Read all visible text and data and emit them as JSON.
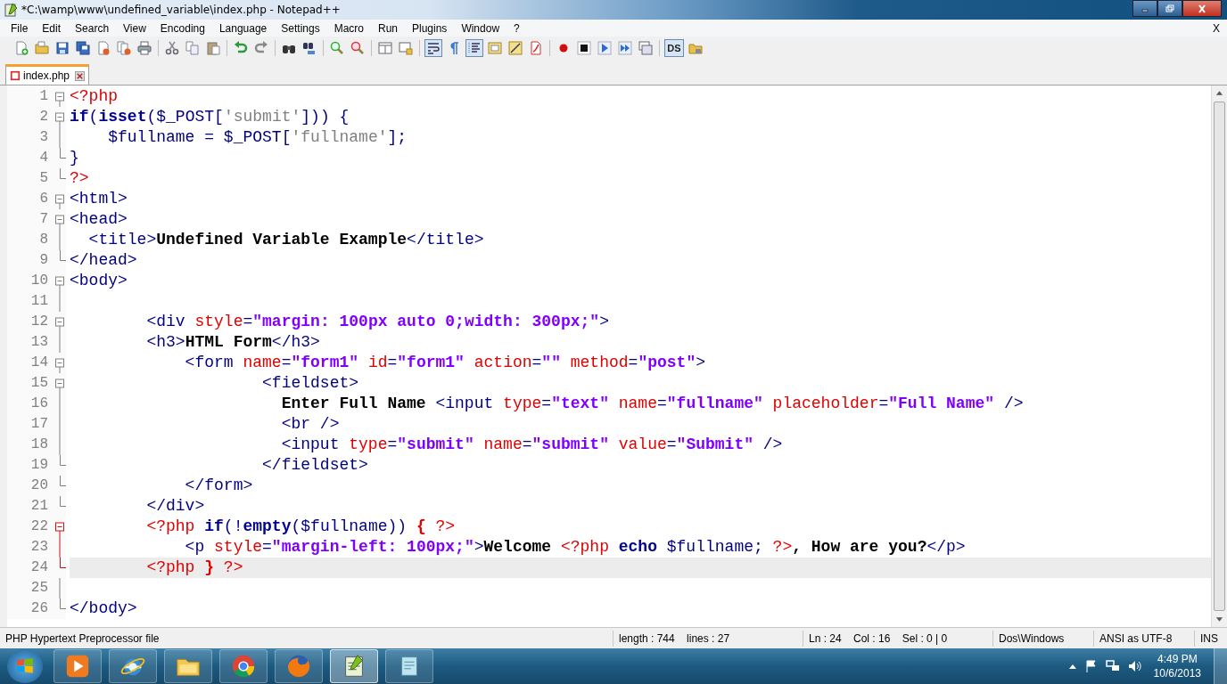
{
  "window": {
    "title": "*C:\\wamp\\www\\undefined_variable\\index.php - Notepad++"
  },
  "menu": [
    "File",
    "Edit",
    "Search",
    "View",
    "Encoding",
    "Language",
    "Settings",
    "Macro",
    "Run",
    "Plugins",
    "Window",
    "?"
  ],
  "menu_close": "X",
  "toolbar": [
    {
      "kind": "new",
      "pressed": false
    },
    {
      "kind": "open",
      "pressed": false
    },
    {
      "kind": "save",
      "pressed": false
    },
    {
      "kind": "save-all",
      "pressed": false
    },
    {
      "kind": "close",
      "pressed": false
    },
    {
      "kind": "close-all",
      "pressed": false
    },
    {
      "kind": "print",
      "pressed": false
    },
    {
      "kind": "sep"
    },
    {
      "kind": "cut",
      "pressed": false
    },
    {
      "kind": "copy",
      "pressed": false
    },
    {
      "kind": "paste",
      "pressed": false
    },
    {
      "kind": "sep"
    },
    {
      "kind": "undo",
      "pressed": false
    },
    {
      "kind": "redo",
      "pressed": false
    },
    {
      "kind": "sep"
    },
    {
      "kind": "find",
      "pressed": false
    },
    {
      "kind": "replace",
      "pressed": false
    },
    {
      "kind": "sep"
    },
    {
      "kind": "zoom-in",
      "pressed": false
    },
    {
      "kind": "zoom-out",
      "pressed": false
    },
    {
      "kind": "sep"
    },
    {
      "kind": "sync-v",
      "pressed": false
    },
    {
      "kind": "sync-h",
      "pressed": false
    },
    {
      "kind": "sep"
    },
    {
      "kind": "wrap",
      "pressed": true
    },
    {
      "kind": "pilcrow",
      "pressed": false
    },
    {
      "kind": "indent",
      "pressed": true
    },
    {
      "kind": "map",
      "pressed": false
    },
    {
      "kind": "function",
      "pressed": false
    },
    {
      "kind": "lang",
      "pressed": false
    },
    {
      "kind": "sep"
    },
    {
      "kind": "record",
      "pressed": false
    },
    {
      "kind": "stop",
      "pressed": false
    },
    {
      "kind": "play",
      "pressed": false
    },
    {
      "kind": "play-many",
      "pressed": false
    },
    {
      "kind": "save-macro",
      "pressed": false
    },
    {
      "kind": "sep"
    },
    {
      "kind": "text",
      "label": "DS",
      "pressed": true
    },
    {
      "kind": "folder-lock",
      "pressed": false
    }
  ],
  "tabs": [
    {
      "label": "index.php",
      "selected": true,
      "modified": true
    }
  ],
  "lines": [
    {
      "number": "1",
      "fold": {
        "kind": "open",
        "active": false
      },
      "current": false,
      "tokens": [
        {
          "kind": "phpdelim",
          "text": "<?php"
        }
      ]
    },
    {
      "number": "2",
      "fold": {
        "kind": "open",
        "active": false
      },
      "current": false,
      "tokens": [
        {
          "kind": "kw",
          "text": "if"
        },
        {
          "kind": "op",
          "text": "("
        },
        {
          "kind": "kw",
          "text": "isset"
        },
        {
          "kind": "op",
          "text": "("
        },
        {
          "kind": "var",
          "text": "$_POST"
        },
        {
          "kind": "op",
          "text": "["
        },
        {
          "kind": "pstr",
          "text": "'submit'"
        },
        {
          "kind": "op",
          "text": "])) {"
        }
      ]
    },
    {
      "number": "3",
      "fold": {
        "kind": "line",
        "active": false
      },
      "current": false,
      "tokens": [
        {
          "kind": "var",
          "text": "    $fullname"
        },
        {
          "kind": "op",
          "text": " = "
        },
        {
          "kind": "var",
          "text": "$_POST"
        },
        {
          "kind": "op",
          "text": "["
        },
        {
          "kind": "pstr",
          "text": "'fullname'"
        },
        {
          "kind": "op",
          "text": "];"
        }
      ]
    },
    {
      "number": "4",
      "fold": {
        "kind": "end",
        "active": false
      },
      "current": false,
      "tokens": [
        {
          "kind": "op",
          "text": "}"
        }
      ]
    },
    {
      "number": "5",
      "fold": {
        "kind": "end",
        "active": false
      },
      "current": false,
      "tokens": [
        {
          "kind": "phpdelim",
          "text": "?>"
        }
      ]
    },
    {
      "number": "6",
      "fold": {
        "kind": "open",
        "active": false
      },
      "current": false,
      "tokens": [
        {
          "kind": "tag",
          "text": "<html>"
        }
      ]
    },
    {
      "number": "7",
      "fold": {
        "kind": "open",
        "active": false
      },
      "current": false,
      "tokens": [
        {
          "kind": "tag",
          "text": "<head>"
        }
      ]
    },
    {
      "number": "8",
      "fold": {
        "kind": "line",
        "active": false
      },
      "current": false,
      "tokens": [
        {
          "kind": "tag",
          "text": "  <title>"
        },
        {
          "kind": "text",
          "text": "Undefined Variable Example"
        },
        {
          "kind": "tag",
          "text": "</title>"
        }
      ]
    },
    {
      "number": "9",
      "fold": {
        "kind": "end",
        "active": false
      },
      "current": false,
      "tokens": [
        {
          "kind": "tag",
          "text": "</head>"
        }
      ]
    },
    {
      "number": "10",
      "fold": {
        "kind": "open",
        "active": false
      },
      "current": false,
      "tokens": [
        {
          "kind": "tag",
          "text": "<body>"
        }
      ]
    },
    {
      "number": "11",
      "fold": {
        "kind": "line",
        "active": false
      },
      "current": false
    },
    {
      "number": "12",
      "fold": {
        "kind": "open",
        "active": false
      },
      "current": false,
      "tokens": [
        {
          "kind": "tag",
          "text": "        <div "
        },
        {
          "kind": "attr",
          "text": "style"
        },
        {
          "kind": "tag",
          "text": "="
        },
        {
          "kind": "str",
          "text": "\"margin: 100px auto 0;width: 300px;\""
        },
        {
          "kind": "tag",
          "text": ">"
        }
      ]
    },
    {
      "number": "13",
      "fold": {
        "kind": "line",
        "active": false
      },
      "current": false,
      "tokens": [
        {
          "kind": "tag",
          "text": "        <h3>"
        },
        {
          "kind": "text",
          "text": "HTML Form"
        },
        {
          "kind": "tag",
          "text": "</h3>"
        }
      ]
    },
    {
      "number": "14",
      "fold": {
        "kind": "open",
        "active": false
      },
      "current": false,
      "tokens": [
        {
          "kind": "tag",
          "text": "            <form "
        },
        {
          "kind": "attr",
          "text": "name"
        },
        {
          "kind": "tag",
          "text": "="
        },
        {
          "kind": "str",
          "text": "\"form1\" "
        },
        {
          "kind": "attr",
          "text": "id"
        },
        {
          "kind": "tag",
          "text": "="
        },
        {
          "kind": "str",
          "text": "\"form1\" "
        },
        {
          "kind": "attr",
          "text": "action"
        },
        {
          "kind": "tag",
          "text": "="
        },
        {
          "kind": "str",
          "text": "\"\" "
        },
        {
          "kind": "attr",
          "text": "method"
        },
        {
          "kind": "tag",
          "text": "="
        },
        {
          "kind": "str",
          "text": "\"post\""
        },
        {
          "kind": "tag",
          "text": ">"
        }
      ]
    },
    {
      "number": "15",
      "fold": {
        "kind": "open",
        "active": false
      },
      "current": false,
      "tokens": [
        {
          "kind": "tag",
          "text": "                    <fieldset>"
        }
      ]
    },
    {
      "number": "16",
      "fold": {
        "kind": "line",
        "active": false
      },
      "current": false,
      "tokens": [
        {
          "kind": "text",
          "text": "                      Enter Full Name "
        },
        {
          "kind": "tag",
          "text": "<input "
        },
        {
          "kind": "attr",
          "text": "type"
        },
        {
          "kind": "tag",
          "text": "="
        },
        {
          "kind": "str",
          "text": "\"text\" "
        },
        {
          "kind": "attr",
          "text": "name"
        },
        {
          "kind": "tag",
          "text": "="
        },
        {
          "kind": "str",
          "text": "\"fullname\" "
        },
        {
          "kind": "attr",
          "text": "placeholder"
        },
        {
          "kind": "tag",
          "text": "="
        },
        {
          "kind": "str",
          "text": "\"Full Name\""
        },
        {
          "kind": "tag",
          "text": " />"
        }
      ]
    },
    {
      "number": "17",
      "fold": {
        "kind": "line",
        "active": false
      },
      "current": false,
      "tokens": [
        {
          "kind": "tag",
          "text": "                      <br />"
        }
      ]
    },
    {
      "number": "18",
      "fold": {
        "kind": "line",
        "active": false
      },
      "current": false,
      "tokens": [
        {
          "kind": "tag",
          "text": "                      <input "
        },
        {
          "kind": "attr",
          "text": "type"
        },
        {
          "kind": "tag",
          "text": "="
        },
        {
          "kind": "str",
          "text": "\"submit\" "
        },
        {
          "kind": "attr",
          "text": "name"
        },
        {
          "kind": "tag",
          "text": "="
        },
        {
          "kind": "str",
          "text": "\"submit\" "
        },
        {
          "kind": "attr",
          "text": "value"
        },
        {
          "kind": "tag",
          "text": "="
        },
        {
          "kind": "str",
          "text": "\"Submit\""
        },
        {
          "kind": "tag",
          "text": " />"
        }
      ]
    },
    {
      "number": "19",
      "fold": {
        "kind": "end",
        "active": false
      },
      "current": false,
      "tokens": [
        {
          "kind": "tag",
          "text": "                    </fieldset>"
        }
      ]
    },
    {
      "number": "20",
      "fold": {
        "kind": "end",
        "active": false
      },
      "current": false,
      "tokens": [
        {
          "kind": "tag",
          "text": "            </form>"
        }
      ]
    },
    {
      "number": "21",
      "fold": {
        "kind": "end",
        "active": false
      },
      "current": false,
      "tokens": [
        {
          "kind": "tag",
          "text": "        </div>"
        }
      ]
    },
    {
      "number": "22",
      "fold": {
        "kind": "open",
        "active": true
      },
      "current": false,
      "tokens": [
        {
          "kind": "phpdelim",
          "text": "        <?php "
        },
        {
          "kind": "kw",
          "text": "if"
        },
        {
          "kind": "op",
          "text": "(!"
        },
        {
          "kind": "kw",
          "text": "empty"
        },
        {
          "kind": "op",
          "text": "("
        },
        {
          "kind": "var",
          "text": "$fullname"
        },
        {
          "kind": "op",
          "text": ")) "
        },
        {
          "kind": "brace",
          "text": "{ "
        },
        {
          "kind": "phpdelim",
          "text": "?>"
        }
      ]
    },
    {
      "number": "23",
      "fold": {
        "kind": "line",
        "active": true
      },
      "current": false,
      "tokens": [
        {
          "kind": "tag",
          "text": "            <p "
        },
        {
          "kind": "attr",
          "text": "style"
        },
        {
          "kind": "tag",
          "text": "="
        },
        {
          "kind": "str",
          "text": "\"margin-left: 100px;\""
        },
        {
          "kind": "tag",
          "text": ">"
        },
        {
          "kind": "text",
          "text": "Welcome "
        },
        {
          "kind": "phpdelim",
          "text": "<?php "
        },
        {
          "kind": "kw",
          "text": "echo "
        },
        {
          "kind": "var",
          "text": "$fullname"
        },
        {
          "kind": "op",
          "text": "; "
        },
        {
          "kind": "phpdelim",
          "text": "?>"
        },
        {
          "kind": "text",
          "text": ", How are you?"
        },
        {
          "kind": "tag",
          "text": "</p>"
        }
      ]
    },
    {
      "number": "24",
      "fold": {
        "kind": "end",
        "active": true
      },
      "current": true,
      "tokens": [
        {
          "kind": "phpdelim",
          "text": "        <?php "
        },
        {
          "kind": "brace",
          "text": "} "
        },
        {
          "kind": "phpdelim",
          "text": "?>"
        }
      ]
    },
    {
      "number": "25",
      "fold": {
        "kind": "line",
        "active": false
      },
      "current": false
    },
    {
      "number": "26",
      "fold": {
        "kind": "end",
        "active": false
      },
      "current": false,
      "tokens": [
        {
          "kind": "tag",
          "text": "</body>"
        }
      ]
    }
  ],
  "status_bar": [
    {
      "text": "PHP Hypertext Preprocessor file",
      "kind": "wide"
    },
    {
      "text": "length : 744    lines : 27",
      "kind": "mid"
    },
    {
      "text": "Ln : 24    Col : 16    Sel : 0 | 0",
      "kind": "mid"
    },
    {
      "text": "Dos\\Windows",
      "kind": "small"
    },
    {
      "text": "ANSI as UTF-8",
      "kind": "small"
    },
    {
      "text": "INS",
      "kind": "tiny"
    }
  ],
  "taskbar": {
    "apps": [
      {
        "kind": "media",
        "selected": false
      },
      {
        "kind": "ie",
        "selected": false
      },
      {
        "kind": "folder",
        "selected": false
      },
      {
        "kind": "chrome",
        "selected": false
      },
      {
        "kind": "firefox",
        "selected": false
      },
      {
        "kind": "npp",
        "selected": true
      },
      {
        "kind": "note",
        "selected": false
      }
    ],
    "time": "4:49 PM",
    "date": "10/6/2013"
  }
}
